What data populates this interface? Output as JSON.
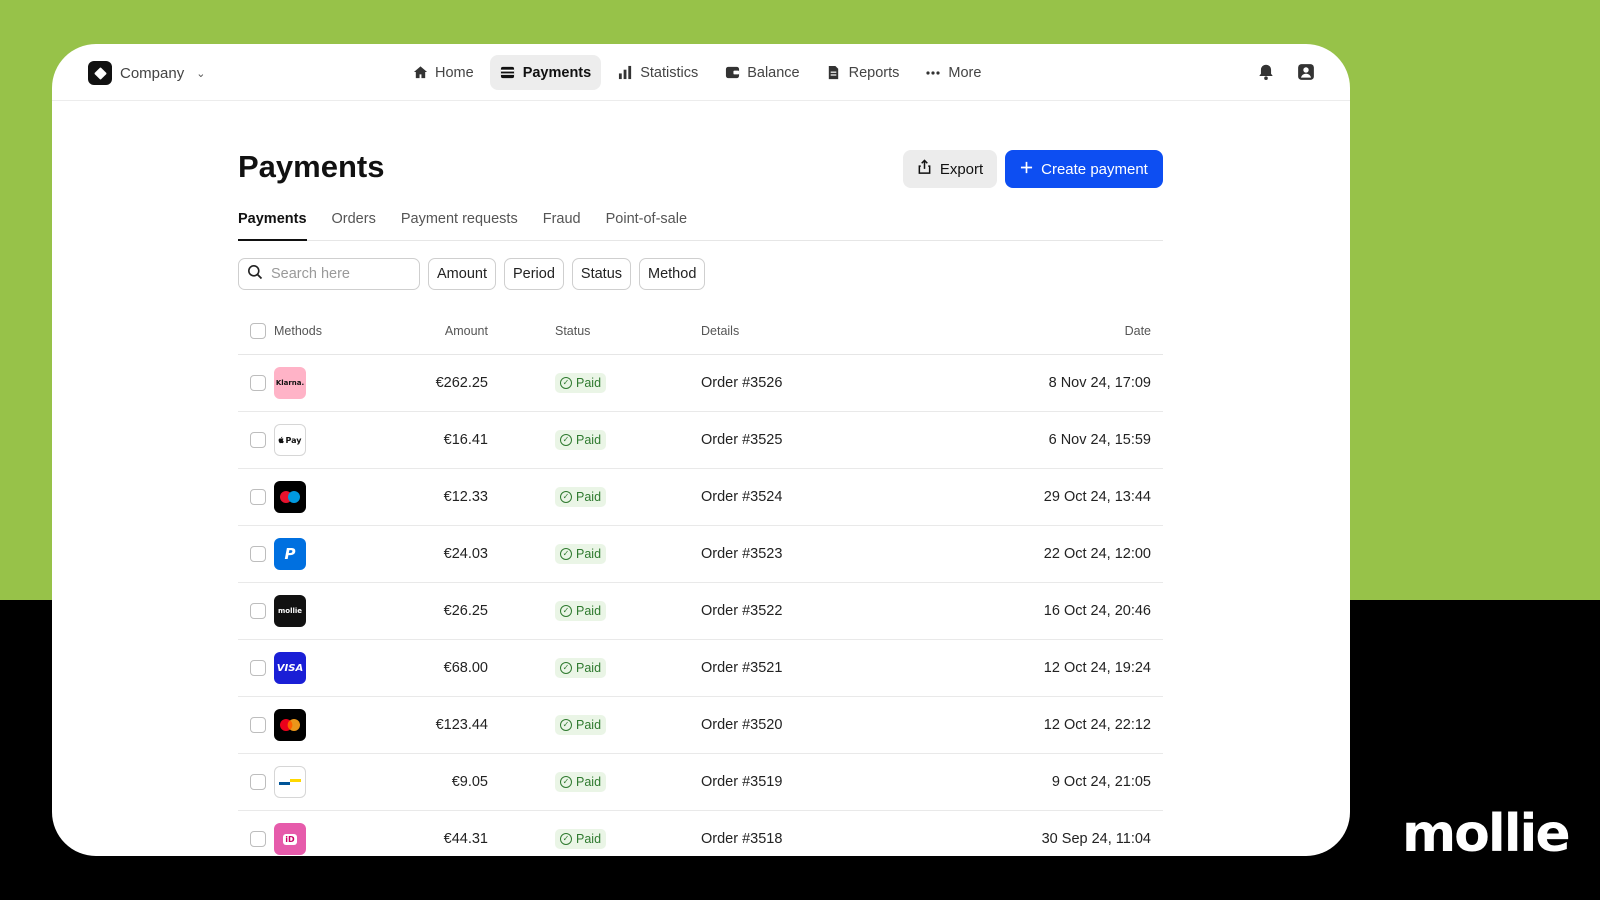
{
  "brand": {
    "wordmark": "mollie"
  },
  "header": {
    "company": "Company",
    "nav": [
      {
        "label": "Home",
        "icon": "home-icon",
        "active": false
      },
      {
        "label": "Payments",
        "icon": "payments-icon",
        "active": true
      },
      {
        "label": "Statistics",
        "icon": "statistics-icon",
        "active": false
      },
      {
        "label": "Balance",
        "icon": "balance-icon",
        "active": false
      },
      {
        "label": "Reports",
        "icon": "reports-icon",
        "active": false
      },
      {
        "label": "More",
        "icon": "more-icon",
        "active": false
      }
    ]
  },
  "page": {
    "title": "Payments",
    "export_label": "Export",
    "create_label": "Create payment"
  },
  "tabs": [
    "Payments",
    "Orders",
    "Payment requests",
    "Fraud",
    "Point-of-sale"
  ],
  "filters": {
    "search_placeholder": "Search here",
    "chips": [
      "Amount",
      "Period",
      "Status",
      "Method"
    ]
  },
  "table": {
    "columns": {
      "methods": "Methods",
      "amount": "Amount",
      "status": "Status",
      "details": "Details",
      "date": "Date"
    },
    "rows": [
      {
        "method": "klarna",
        "method_text": "Klarna.",
        "amount": "€262.25",
        "status": "Paid",
        "details": "Order #3526",
        "date": "8 Nov 24, 17:09"
      },
      {
        "method": "apple-pay",
        "method_text": "Pay",
        "amount": "€16.41",
        "status": "Paid",
        "details": "Order #3525",
        "date": "6 Nov 24, 15:59"
      },
      {
        "method": "maestro",
        "method_text": "",
        "amount": "€12.33",
        "status": "Paid",
        "details": "Order #3524",
        "date": "29 Oct 24, 13:44"
      },
      {
        "method": "paypal",
        "method_text": "P",
        "amount": "€24.03",
        "status": "Paid",
        "details": "Order #3523",
        "date": "22 Oct 24, 12:00"
      },
      {
        "method": "mollie",
        "method_text": "mollie",
        "amount": "€26.25",
        "status": "Paid",
        "details": "Order #3522",
        "date": "16 Oct 24, 20:46"
      },
      {
        "method": "visa",
        "method_text": "VISA",
        "amount": "€68.00",
        "status": "Paid",
        "details": "Order #3521",
        "date": "12 Oct 24, 19:24"
      },
      {
        "method": "mastercard",
        "method_text": "",
        "amount": "€123.44",
        "status": "Paid",
        "details": "Order #3520",
        "date": "12 Oct 24, 22:12"
      },
      {
        "method": "bancontact",
        "method_text": "",
        "amount": "€9.05",
        "status": "Paid",
        "details": "Order #3519",
        "date": "9 Oct 24, 21:05"
      },
      {
        "method": "ideal",
        "method_text": "iD",
        "amount": "€44.31",
        "status": "Paid",
        "details": "Order #3518",
        "date": "30 Sep 24, 11:04"
      }
    ]
  },
  "colors": {
    "accent": "#0d4ef2",
    "brand_green": "#97c249",
    "paid_bg": "#eaf5e6",
    "paid_fg": "#2f7a2f"
  }
}
